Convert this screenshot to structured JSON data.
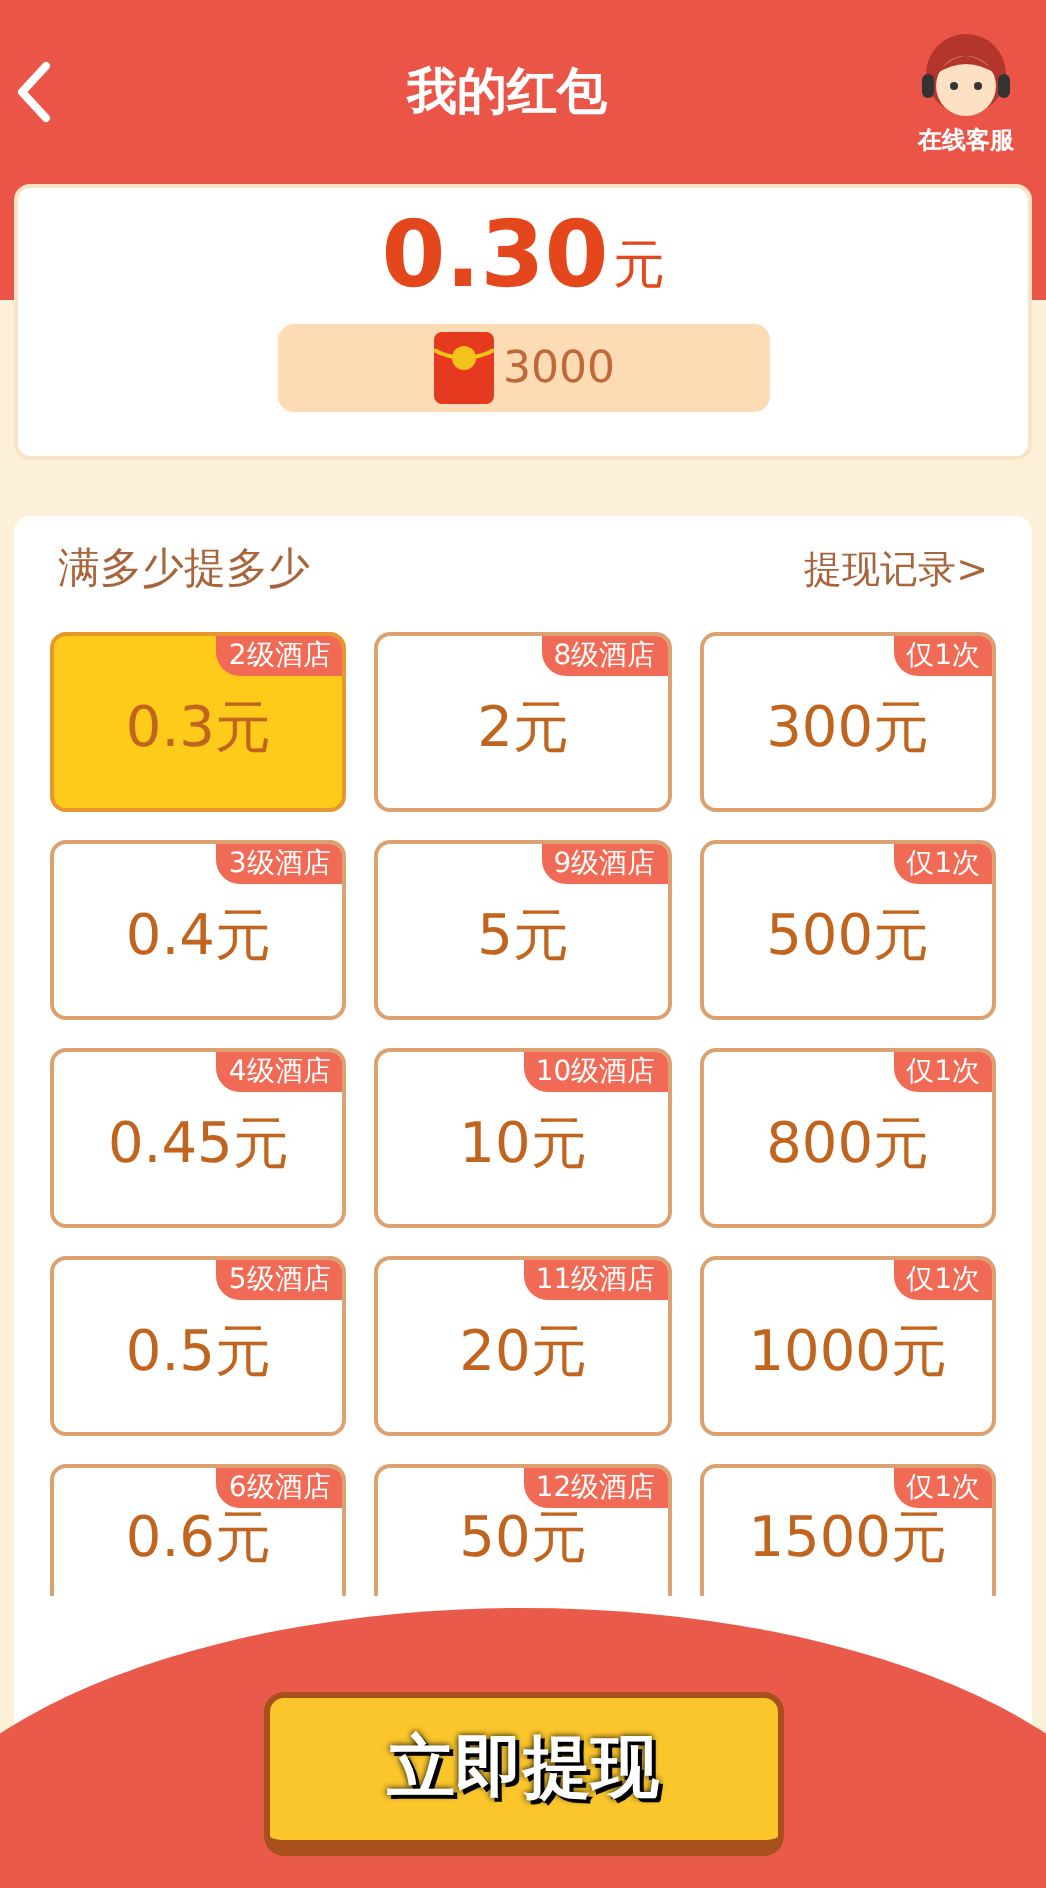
{
  "header": {
    "title": "我的红包",
    "service_label": "在线客服"
  },
  "balance": {
    "amount": "0.30",
    "unit": "元",
    "coins": "3000"
  },
  "withdraw": {
    "heading": "满多少提多少",
    "records_link": "提现记录>",
    "options": [
      {
        "tag": "2级酒店",
        "amount": "0.3元",
        "selected": true
      },
      {
        "tag": "8级酒店",
        "amount": "2元",
        "selected": false
      },
      {
        "tag": "仅1次",
        "amount": "300元",
        "selected": false
      },
      {
        "tag": "3级酒店",
        "amount": "0.4元",
        "selected": false
      },
      {
        "tag": "9级酒店",
        "amount": "5元",
        "selected": false
      },
      {
        "tag": "仅1次",
        "amount": "500元",
        "selected": false
      },
      {
        "tag": "4级酒店",
        "amount": "0.45元",
        "selected": false
      },
      {
        "tag": "10级酒店",
        "amount": "10元",
        "selected": false
      },
      {
        "tag": "仅1次",
        "amount": "800元",
        "selected": false
      },
      {
        "tag": "5级酒店",
        "amount": "0.5元",
        "selected": false
      },
      {
        "tag": "11级酒店",
        "amount": "20元",
        "selected": false
      },
      {
        "tag": "仅1次",
        "amount": "1000元",
        "selected": false
      },
      {
        "tag": "6级酒店",
        "amount": "0.6元",
        "selected": false
      },
      {
        "tag": "12级酒店",
        "amount": "50元",
        "selected": false
      },
      {
        "tag": "仅1次",
        "amount": "1500元",
        "selected": false
      }
    ]
  },
  "action_button": "立即提现"
}
